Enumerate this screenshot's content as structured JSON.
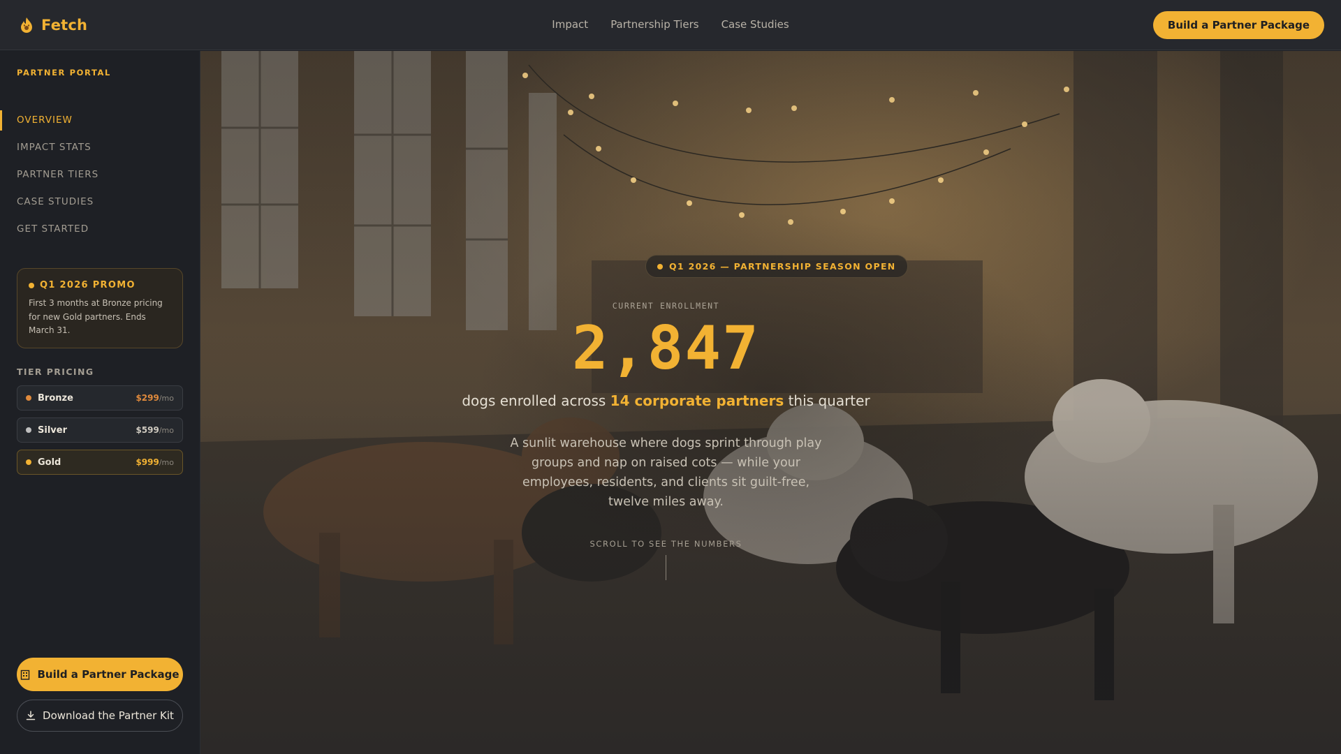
{
  "header": {
    "brand": "Fetch",
    "nav": [
      "Impact",
      "Partnership Tiers",
      "Case Studies"
    ],
    "cta": "Build a Partner Package"
  },
  "sidebar": {
    "portal_label": "PARTNER PORTAL",
    "items": [
      {
        "label": "OVERVIEW",
        "active": true
      },
      {
        "label": "IMPACT STATS",
        "active": false
      },
      {
        "label": "PARTNER TIERS",
        "active": false
      },
      {
        "label": "CASE STUDIES",
        "active": false
      },
      {
        "label": "GET STARTED",
        "active": false
      }
    ],
    "promo": {
      "title": "Q1 2026 PROMO",
      "text": "First 3 months at Bronze pricing for new Gold partners. Ends March 31."
    },
    "tier_label": "TIER PRICING",
    "tiers": [
      {
        "name": "Bronze",
        "price": "$299",
        "per": "/mo",
        "color": "#e08a3c"
      },
      {
        "name": "Silver",
        "price": "$599",
        "per": "/mo",
        "color": "#bfbfbf"
      },
      {
        "name": "Gold",
        "price": "$999",
        "per": "/mo",
        "color": "#f2b233"
      }
    ],
    "cta": "Build a Partner Package",
    "download": "Download the Partner Kit"
  },
  "hero": {
    "season_badge": "Q1 2026 — PARTNERSHIP SEASON OPEN",
    "enroll_label": "CURRENT ENROLLMENT",
    "enroll_count": "2,847",
    "sub_prefix": "dogs enrolled across ",
    "sub_highlight": "14 corporate partners",
    "sub_suffix": " this quarter",
    "description": "A sunlit warehouse where dogs sprint through play groups and nap on raised cots — while your employees, residents, and clients sit guilt-free, twelve miles away.",
    "scroll_hint": "SCROLL TO SEE THE NUMBERS"
  },
  "colors": {
    "accent": "#f2b233",
    "background": "#1d1f24",
    "topbar": "#26282d"
  },
  "icons": {
    "brand": "flame-paw-icon",
    "cta": "building-icon",
    "download": "download-icon"
  }
}
